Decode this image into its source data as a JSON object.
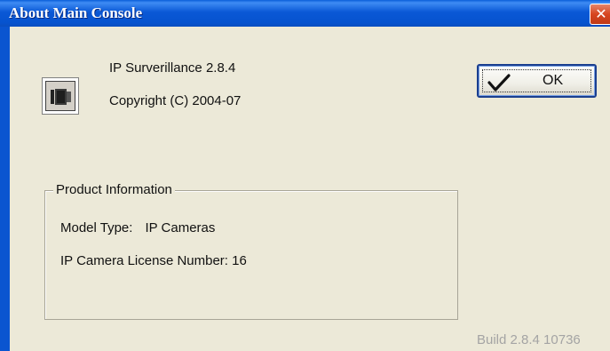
{
  "window": {
    "title": "About Main Console",
    "close_glyph": "✕"
  },
  "app": {
    "icon": "camera-icon",
    "product_name": "IP Surverillance 2.8.4",
    "copyright": "Copyright (C) 2004-07"
  },
  "ok_button": {
    "icon": "checkmark-icon",
    "label": "OK"
  },
  "product_info": {
    "legend": "Product Information",
    "model_type_label": "Model Type:",
    "model_type_value": "IP Cameras",
    "license_label": "IP Camera License Number:",
    "license_value": "16"
  },
  "build": "Build 2.8.4 10736",
  "colors": {
    "titlebar": "#0a58d6",
    "close_button": "#d7461f",
    "dialog_bg": "#ece9d8",
    "build_text": "#a4a4a4"
  }
}
